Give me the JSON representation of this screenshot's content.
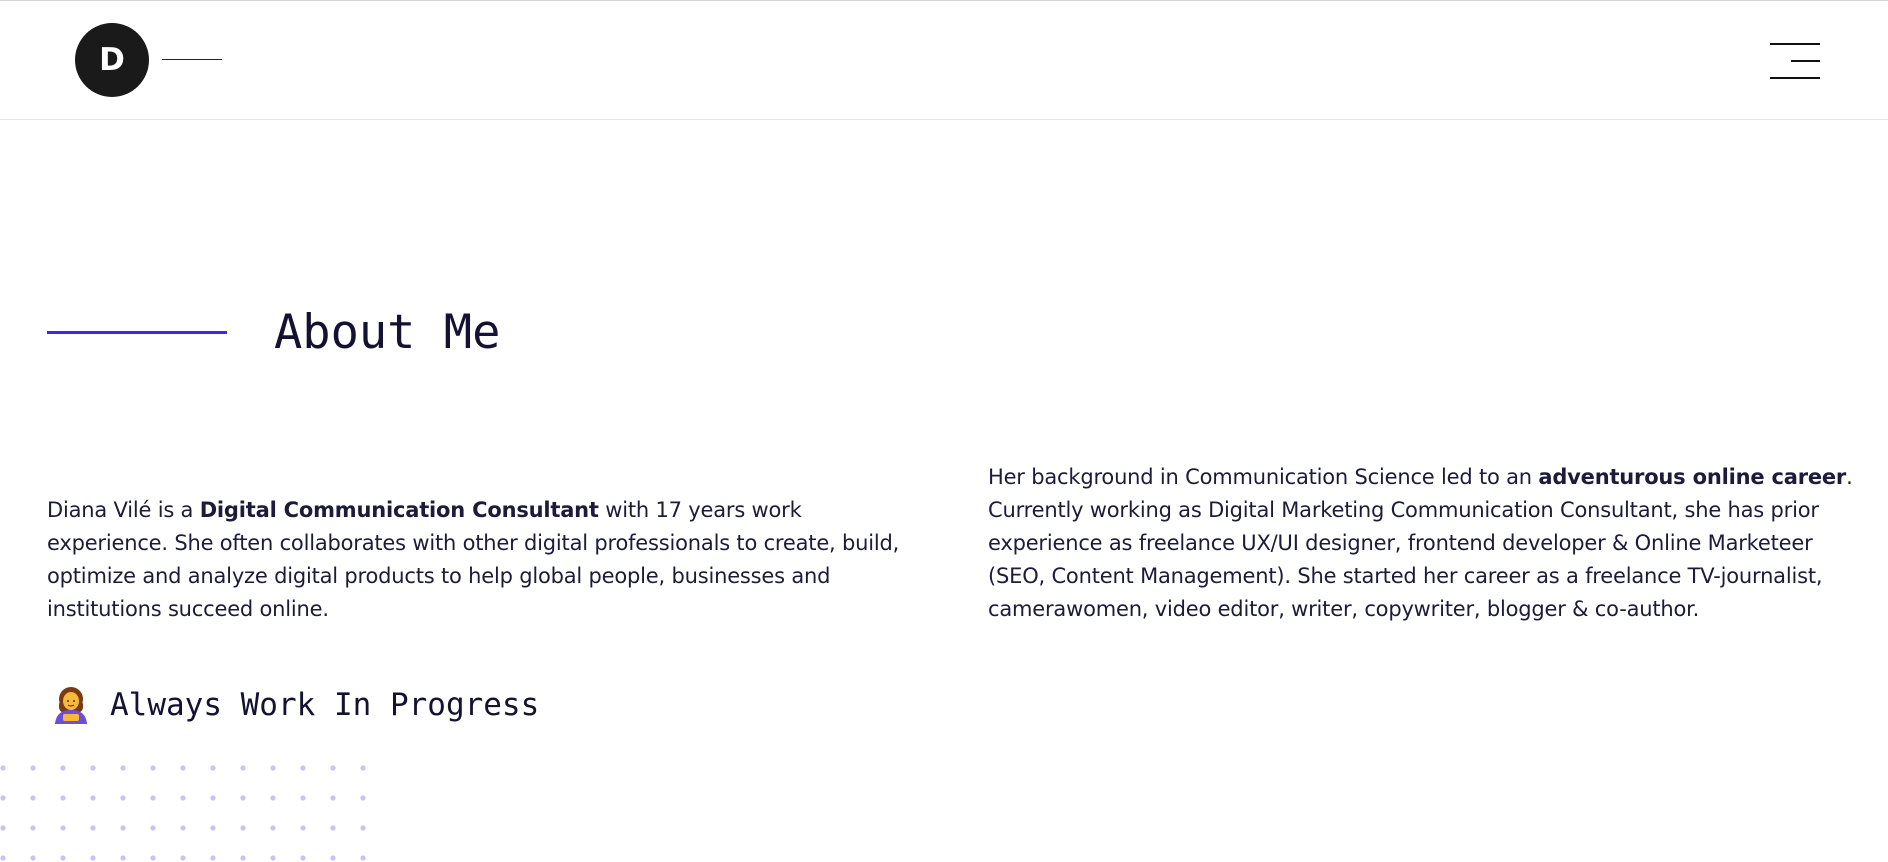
{
  "header": {
    "logo_letter": "D",
    "menu_icon": "hamburger-menu-icon"
  },
  "about": {
    "title": "About Me",
    "accent_color": "#3f27e6",
    "left": {
      "pre": "Diana Vilé is a ",
      "bold": "Digital Communication Consultant",
      "post": " with 17 years work experience. She often collaborates with other digital professionals to create, build, optimize and analyze digital products to help global people, businesses and institutions succeed online."
    },
    "right": {
      "pre": "Her background in Communication Science led to an ",
      "bold": "adventurous online career",
      "post": ". Currently working as Digital Marketing Communication Consultant, she has prior experience as freelance UX/UI designer, frontend developer & Online Marketeer (SEO, Content Management). She started her career as a freelance TV-journalist, camerawomen, video editor, writer, copywriter, blogger & co-author."
    },
    "wip_icon": "woman-technologist-icon",
    "wip_text": "Always Work In Progress"
  },
  "decoration": {
    "dot_color": "#c9c2f5"
  }
}
